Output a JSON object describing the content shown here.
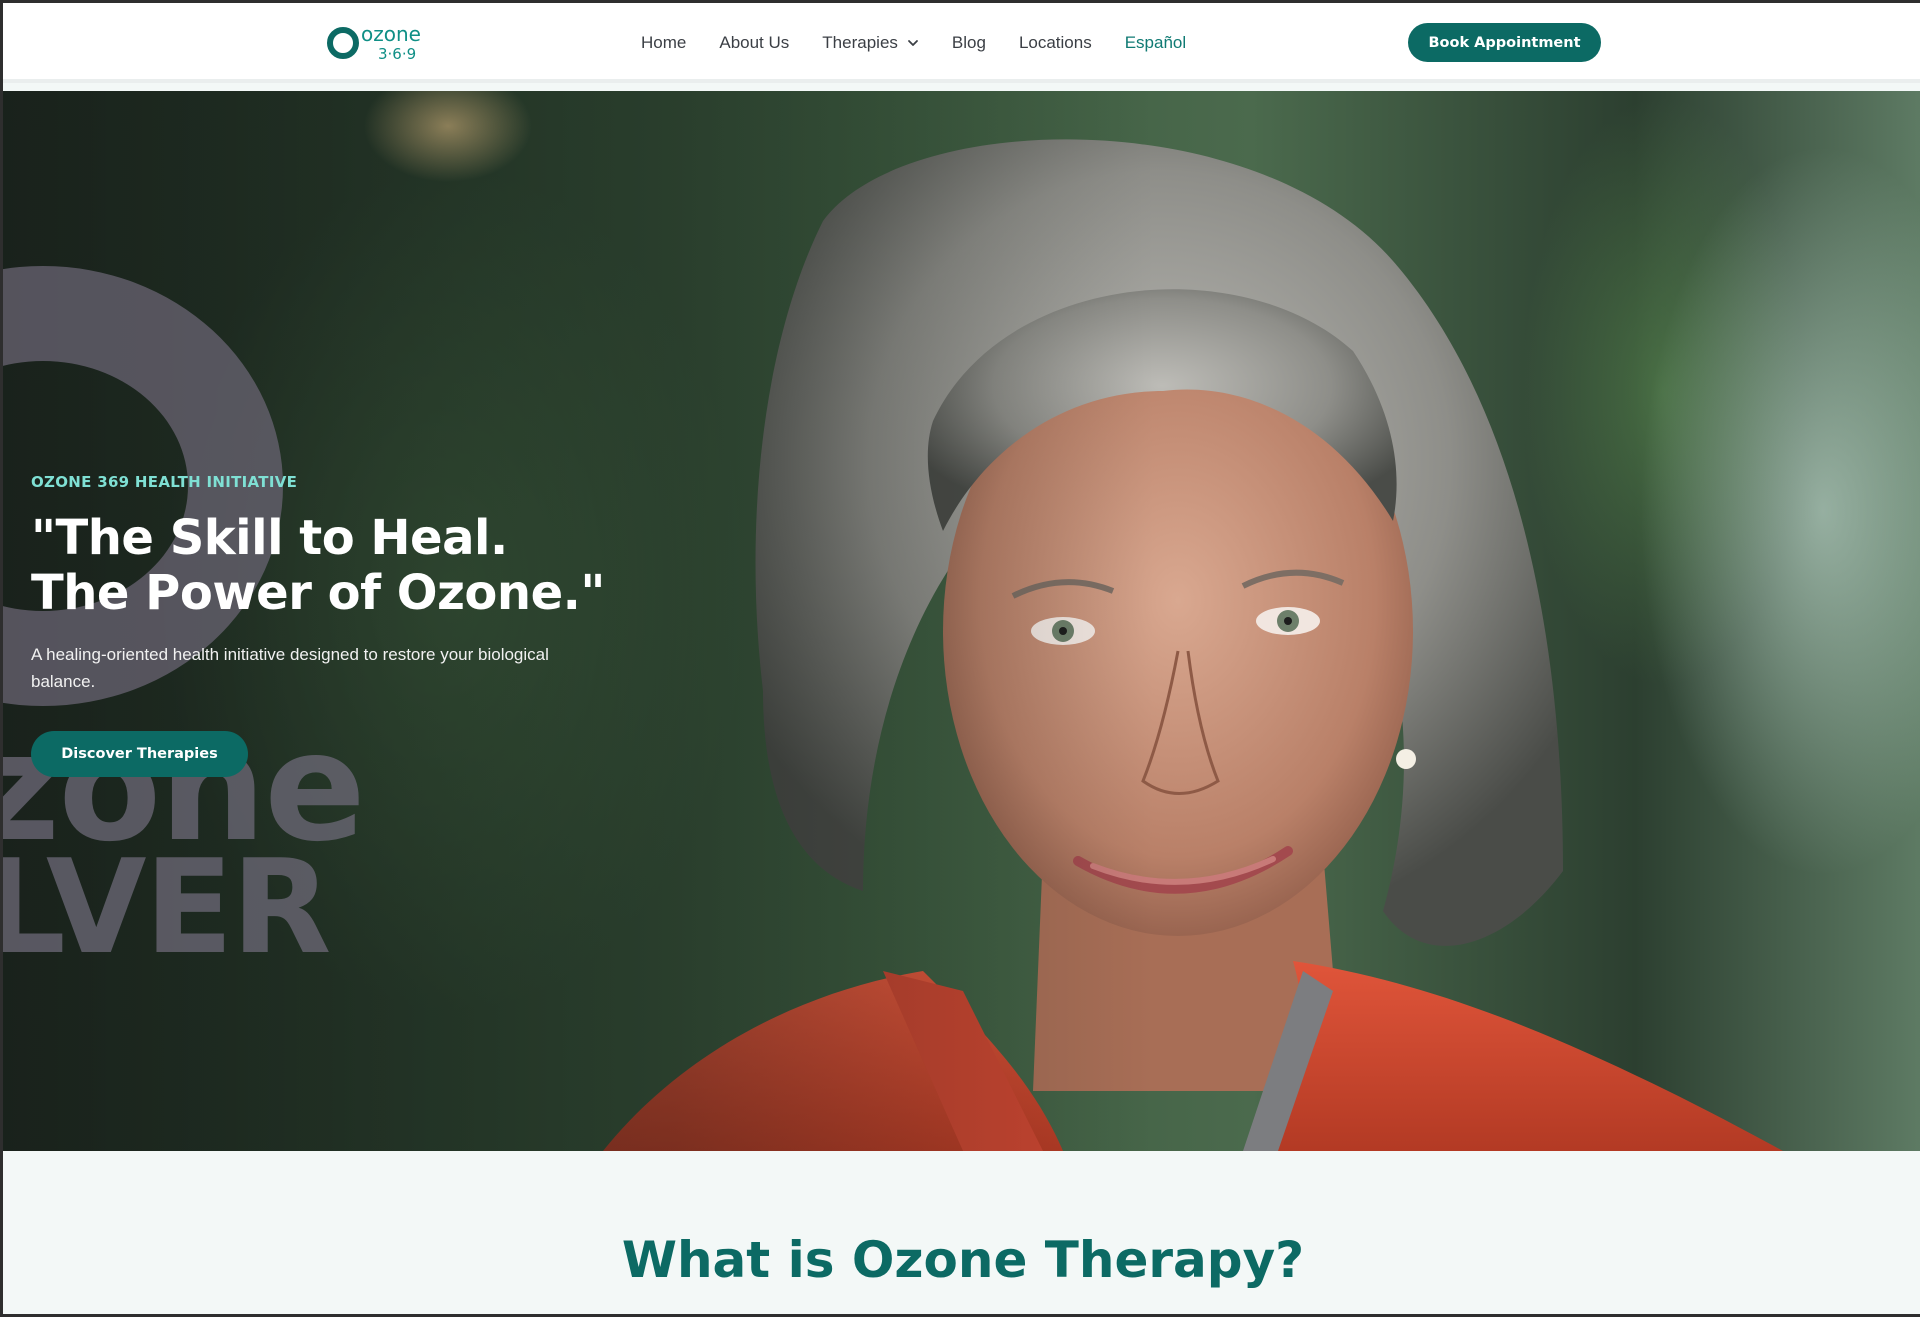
{
  "colors": {
    "brand": "#0c6a64",
    "eyebrow": "#7fe0d4",
    "active_nav": "#0f7a73",
    "section_bg": "#f3f8f7"
  },
  "header": {
    "logo_text": "ozone",
    "logo_subtext": "3·6·9",
    "nav": [
      {
        "label": "Home"
      },
      {
        "label": "About Us"
      },
      {
        "label": "Therapies",
        "icon": "chevron-down-icon"
      },
      {
        "label": "Blog"
      },
      {
        "label": "Locations"
      },
      {
        "label": "Español",
        "active": true
      }
    ],
    "book_button": "Book Appointment"
  },
  "hero": {
    "eyebrow": "OZONE 369 HEALTH INITIATIVE",
    "headline_line1": "\"The Skill to Heal.",
    "headline_line2": "The Power of Ozone.\"",
    "subtitle": "A healing-oriented health initiative designed to restore your biological balance.",
    "cta": "Discover Therapies",
    "watermark_line1": "zone",
    "watermark_line2": "LVER"
  },
  "section": {
    "title": "What is Ozone Therapy?"
  }
}
